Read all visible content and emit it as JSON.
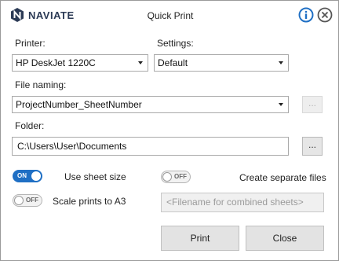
{
  "brand": {
    "name": "NAVIATE"
  },
  "window": {
    "title": "Quick Print"
  },
  "header": {
    "info_icon": "info-icon",
    "close_icon": "close-icon"
  },
  "printer": {
    "label": "Printer:",
    "value": "HP DeskJet 1220C"
  },
  "settings": {
    "label": "Settings:",
    "value": "Default"
  },
  "file_naming": {
    "label": "File naming:",
    "value": "ProjectNumber_SheetNumber",
    "button": "..."
  },
  "folder": {
    "label": "Folder:",
    "value": "C:\\Users\\User\\Documents",
    "button": "..."
  },
  "toggles": {
    "use_sheet_size": {
      "state": "ON",
      "label": "Use sheet size"
    },
    "create_separate_files": {
      "state": "OFF",
      "label": "Create separate files"
    },
    "scale_prints": {
      "state": "OFF",
      "label": "Scale prints to A3"
    }
  },
  "combined_filename": {
    "placeholder": "<Filename for combined sheets>"
  },
  "buttons": {
    "print": "Print",
    "close": "Close"
  },
  "colors": {
    "accent": "#1f6fc4",
    "brand": "#2b3a55"
  }
}
